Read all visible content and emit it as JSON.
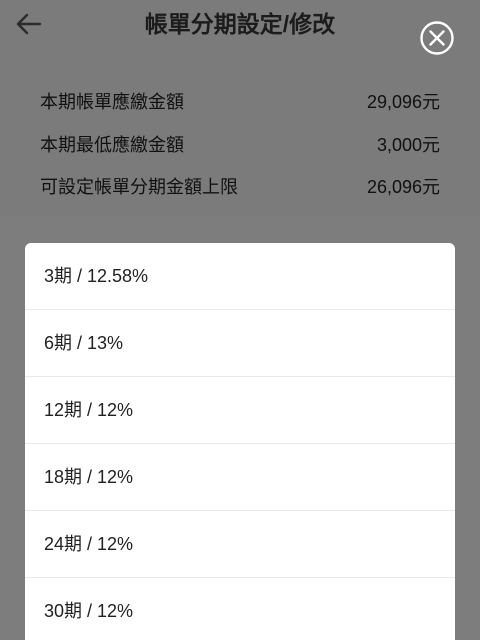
{
  "header": {
    "title": "帳單分期設定/修改"
  },
  "summary": [
    {
      "label": "本期帳單應繳金額",
      "value": "29,096元"
    },
    {
      "label": "本期最低應繳金額",
      "value": "3,000元"
    },
    {
      "label": "可設定帳單分期金額上限",
      "value": "26,096元"
    }
  ],
  "options": [
    {
      "label": "3期 / 12.58%"
    },
    {
      "label": "6期 / 13%"
    },
    {
      "label": "12期 / 12%"
    },
    {
      "label": "18期 / 12%"
    },
    {
      "label": "24期 / 12%"
    },
    {
      "label": "30期 / 12%"
    }
  ],
  "colors": {
    "overlay": "#7d7d7d",
    "sheet": "#ffffff",
    "text": "#222222"
  },
  "icons": {
    "back": "back-arrow-icon",
    "close": "close-circle-icon"
  }
}
